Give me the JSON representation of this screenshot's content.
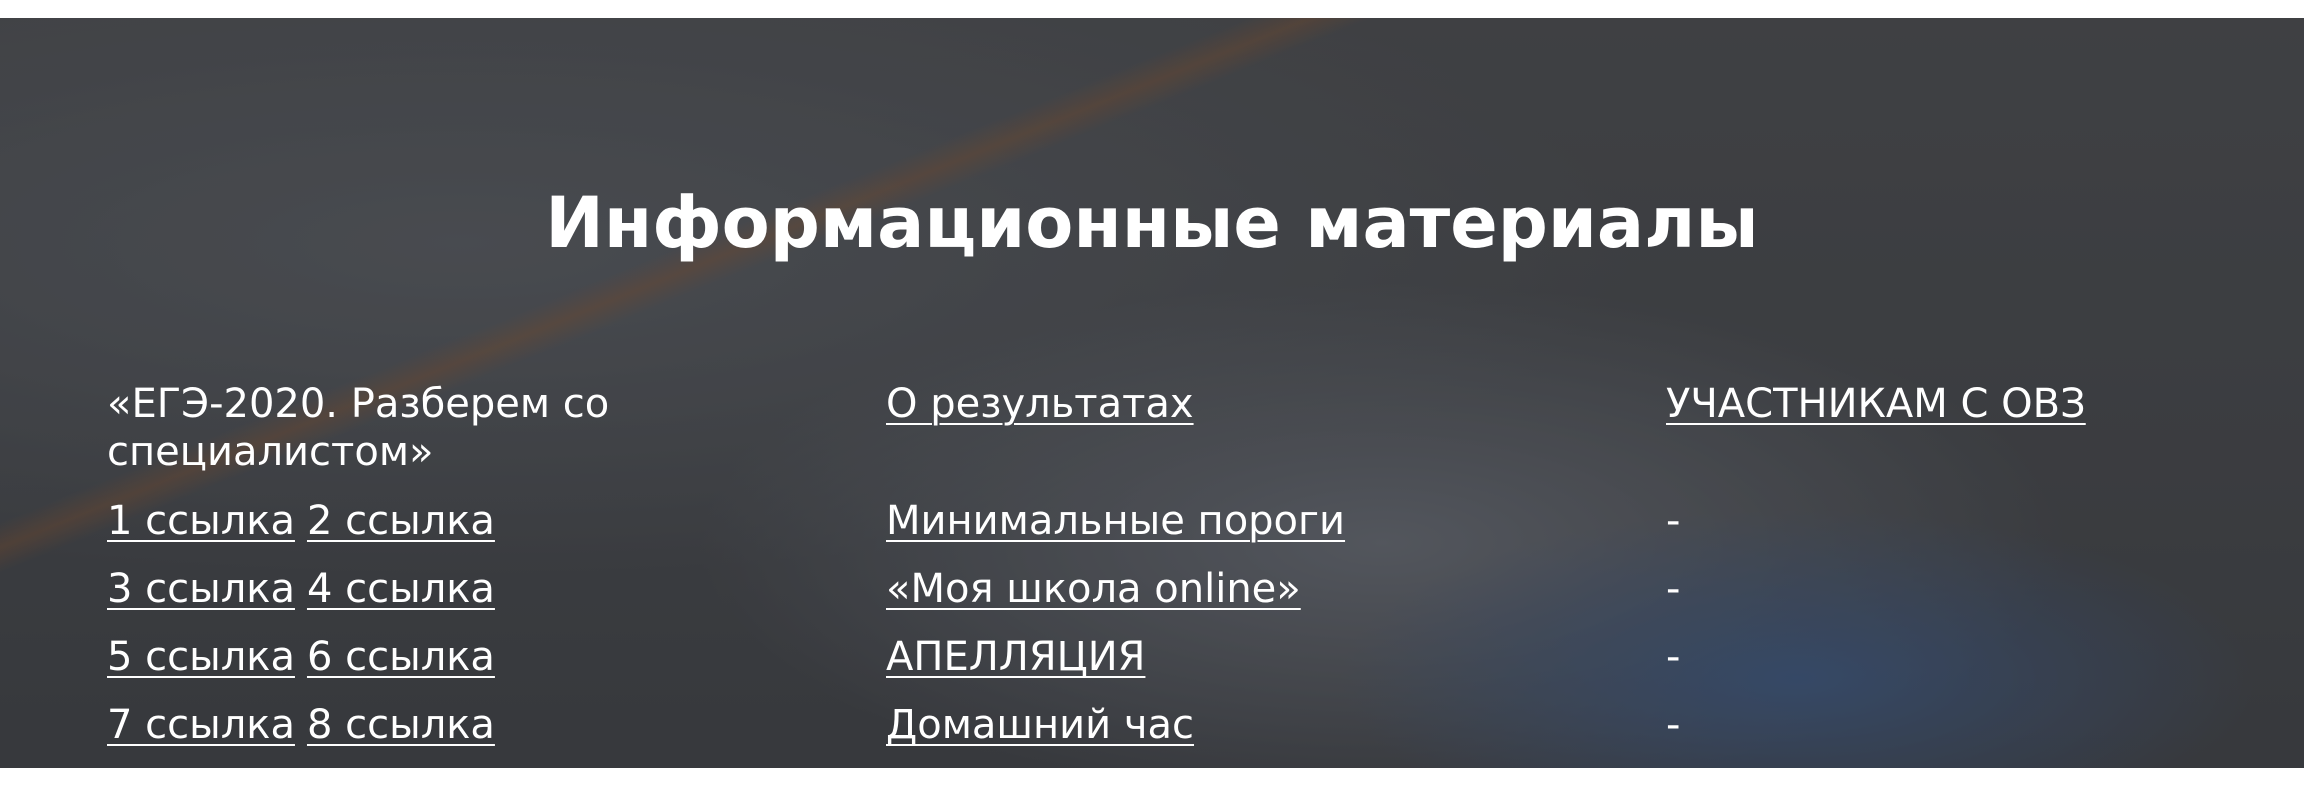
{
  "section": {
    "title": "Информационные материалы"
  },
  "column1": {
    "heading": "«ЕГЭ-2020. Разберем со специалистом»",
    "rows": [
      [
        "1 ссылка",
        "2 ссылка"
      ],
      [
        "3 ссылка",
        "4 ссылка"
      ],
      [
        "5 ссылка",
        "6 ссылка"
      ],
      [
        "7 ссылка",
        "8 ссылка"
      ]
    ]
  },
  "column2": {
    "heading": "О результатах",
    "items": [
      "Минимальные пороги",
      "«Моя школа online»",
      "АПЕЛЛЯЦИЯ",
      "Домашний час"
    ]
  },
  "column3": {
    "heading": "УЧАСТНИКАМ С ОВЗ",
    "items": [
      "-",
      "-",
      "-",
      "-"
    ]
  }
}
